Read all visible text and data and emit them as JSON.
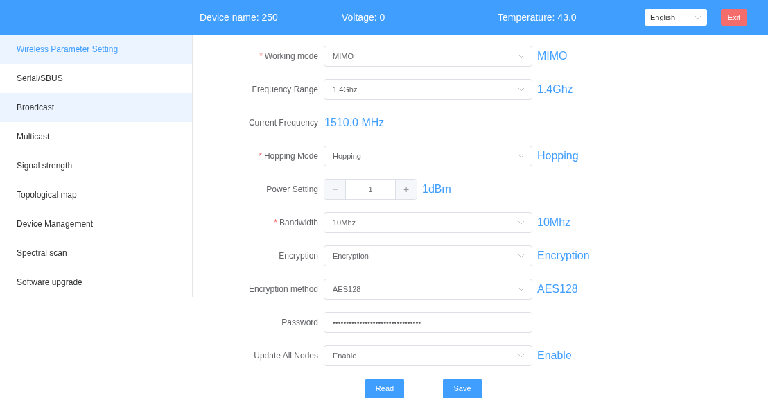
{
  "header": {
    "device_name": "Device name: 250",
    "voltage": "Voltage: 0",
    "temperature": "Temperature: 43.0",
    "language": "English",
    "exit_button": "Exit"
  },
  "sidebar": {
    "items": [
      {
        "label": "Wireless Parameter Setting",
        "selected": true,
        "hovered": false
      },
      {
        "label": "Serial/SBUS",
        "selected": false,
        "hovered": false
      },
      {
        "label": "Broadcast",
        "selected": false,
        "hovered": true
      },
      {
        "label": "Multicast",
        "selected": false,
        "hovered": false
      },
      {
        "label": "Signal strength",
        "selected": false,
        "hovered": false
      },
      {
        "label": "Topological map",
        "selected": false,
        "hovered": false
      },
      {
        "label": "Device Management",
        "selected": false,
        "hovered": false
      },
      {
        "label": "Spectral scan",
        "selected": false,
        "hovered": false
      },
      {
        "label": "Software upgrade",
        "selected": false,
        "hovered": false
      }
    ]
  },
  "form": {
    "rows": [
      {
        "kind": "select",
        "required_mark": "*",
        "label": "Working mode",
        "value": "MIMO",
        "reading": "MIMO"
      },
      {
        "kind": "select",
        "label": "Frequency Range",
        "value": "1.4Ghz",
        "reading": "1.4Ghz"
      },
      {
        "kind": "text",
        "label": "Current Frequency",
        "reading": "1510.0 MHz"
      },
      {
        "kind": "select",
        "required_mark": "*",
        "label": "Hopping Mode",
        "value": "Hopping",
        "reading": "Hopping"
      },
      {
        "kind": "stepper",
        "label": "Power Setting",
        "minus": "−",
        "value": "1",
        "plus": "+",
        "reading": "1dBm"
      },
      {
        "kind": "select",
        "required_mark": "*",
        "label": "Bandwidth",
        "value": "10Mhz",
        "reading": "10Mhz"
      },
      {
        "kind": "select",
        "label": "Encryption",
        "value": "Encryption",
        "reading": "Encryption"
      },
      {
        "kind": "select",
        "label": "Encryption method",
        "value": "AES128",
        "reading": "AES128"
      },
      {
        "kind": "password",
        "label": "Password",
        "value": "•••••••••••••••••••••••••••••••••"
      },
      {
        "kind": "select",
        "label": "Update All Nodes",
        "value": "Enable",
        "reading": "Enable"
      }
    ],
    "buttons": [
      "Read",
      "Save"
    ]
  }
}
